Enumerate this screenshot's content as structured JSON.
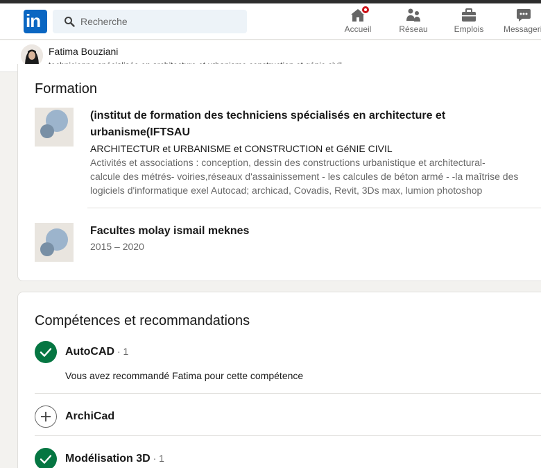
{
  "nav": {
    "search_placeholder": "Recherche",
    "items": [
      {
        "label": "Accueil",
        "icon": "home-icon"
      },
      {
        "label": "Réseau",
        "icon": "network-icon"
      },
      {
        "label": "Emplois",
        "icon": "jobs-icon"
      },
      {
        "label": "Messagerie",
        "icon": "messaging-icon"
      }
    ]
  },
  "profile": {
    "name": "Fatima Bouziani",
    "headline": "technicienne spécialisée en architecture et urbanisme construction et génie civil"
  },
  "formation": {
    "title": "Formation",
    "entries": [
      {
        "school_line1": "(institut de formation des techniciens spécialisés en architecture et",
        "school_line2": "urbanisme(IFTSAU",
        "degree": "ARCHITECTUR et URBANISME et CONSTRUCTION et GéNIE CIVIL",
        "activities_line1": "Activités et associations : conception, dessin des constructions urbanistique et architectural-",
        "activities_line2": "calcule des métrés- voiries,réseaux d'assainissement - les calcules de béton armé - -la maîtrise des",
        "activities_line3": "logiciels d'informatique exel Autocad; archicad, Covadis, Revit, 3Ds max, lumion photoshop"
      },
      {
        "school": "Facultes molay ismail meknes",
        "dates": "2015 – 2020"
      }
    ]
  },
  "skills": {
    "title": "Compétences et recommandations",
    "items": [
      {
        "name": "AutoCAD",
        "count": " · 1",
        "status": "endorsed",
        "note": "Vous avez recommandé Fatima pour cette compétence"
      },
      {
        "name": "ArchiCad",
        "count": "",
        "status": "add"
      },
      {
        "name": "Modélisation 3D",
        "count": " · 1",
        "status": "endorsed"
      }
    ]
  },
  "colors": {
    "brand": "#0a66c2",
    "endorsed_green": "#057642",
    "badge_red": "#cc1016"
  }
}
